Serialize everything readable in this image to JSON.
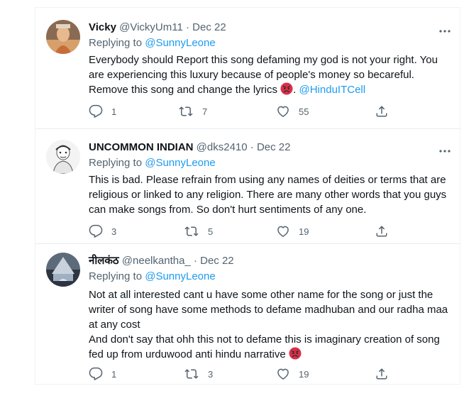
{
  "tweets": [
    {
      "name": "Vicky",
      "handle": "@VickyUm11",
      "separator": "·",
      "date": "Dec 22",
      "replying_prefix": "Replying to ",
      "replying_to": "@SunnyLeone",
      "body_text": "Everybody should Report this song defaming my god is not your right. You are experiencing this luxury because of people's money so becareful. Remove this song and change the lyrics",
      "body_after_emoji": ". ",
      "body_mention": "@HinduITCell",
      "emoji": "angry-face",
      "replies": "1",
      "retweets": "7",
      "likes": "55"
    },
    {
      "name": "UNCOMMON INDIAN",
      "handle": "@dks2410",
      "separator": "·",
      "date": "Dec 22",
      "replying_prefix": "Replying to ",
      "replying_to": "@SunnyLeone",
      "body_text": "This is bad. Please refrain from using any names of deities or terms that are religious or linked to any religion. There are many other words that you guys can make songs from. So don't hurt sentiments of any one.",
      "replies": "3",
      "retweets": "5",
      "likes": "19"
    },
    {
      "name": "नीलकंठ",
      "handle": "@neelkantha_",
      "separator": "·",
      "date": "Dec 22",
      "replying_prefix": "Replying to ",
      "replying_to": "@SunnyLeone",
      "body_line1": "Not at all interested cant u have some other name for the song or just the writer of song have some methods to defame madhuban and our radha maa at any cost",
      "body_line2": "And don't say that ohh this not to defame this is imaginary creation of song fed up from urduwood anti hindu narrative",
      "emoji": "angry-face",
      "replies": "1",
      "retweets": "3",
      "likes": "19"
    }
  ],
  "colors": {
    "link": "#1d9bf0",
    "muted": "#536471",
    "text": "#0f1419",
    "divider": "#e6ecf0"
  },
  "icons": [
    "reply-icon",
    "retweet-icon",
    "like-icon",
    "share-icon",
    "more-icon",
    "angry-face-emoji"
  ]
}
